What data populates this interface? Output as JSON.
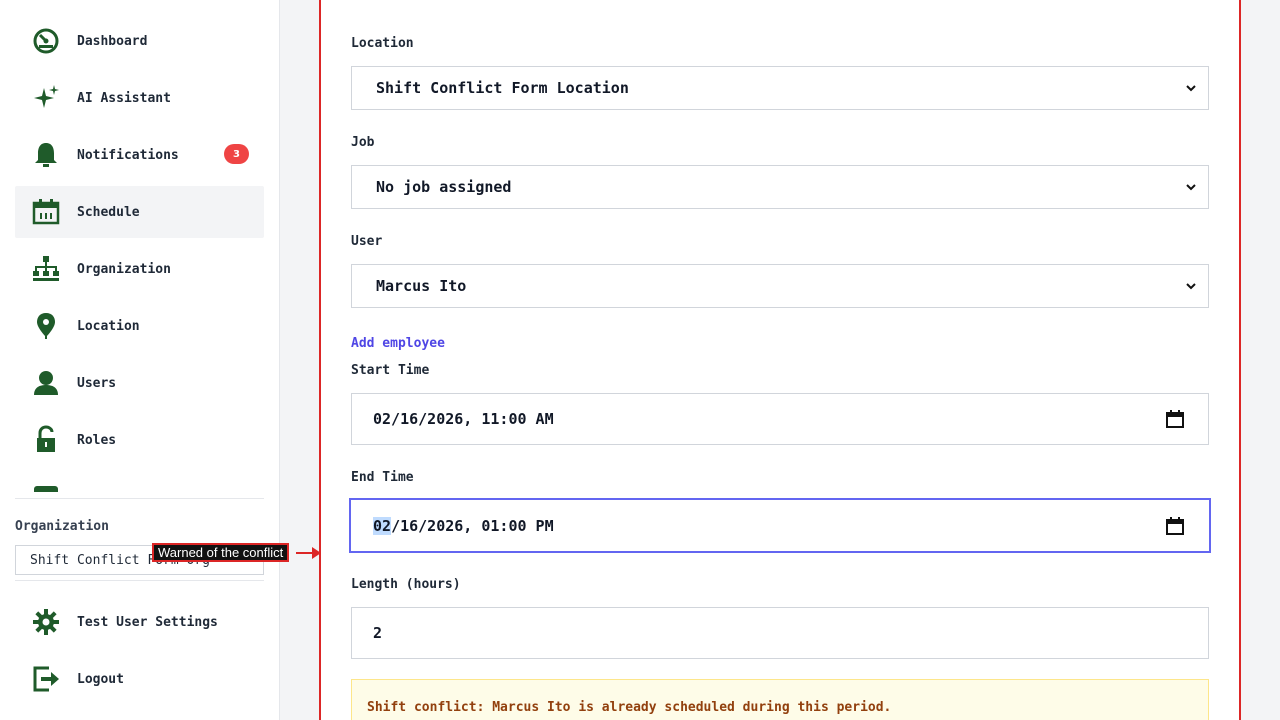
{
  "sidebar": {
    "items": [
      {
        "label": "Dashboard",
        "icon": "dashboard-icon"
      },
      {
        "label": "AI Assistant",
        "icon": "sparkle-icon"
      },
      {
        "label": "Notifications",
        "icon": "bell-icon",
        "badge": "3"
      },
      {
        "label": "Schedule",
        "icon": "calendar-icon",
        "active": true
      },
      {
        "label": "Organization",
        "icon": "org-chart-icon"
      },
      {
        "label": "Location",
        "icon": "map-pin-icon"
      },
      {
        "label": "Users",
        "icon": "user-icon"
      },
      {
        "label": "Roles",
        "icon": "unlock-icon"
      }
    ],
    "organization": {
      "label": "Organization",
      "value": "Shift Conflict Form Org"
    },
    "bottom": [
      {
        "label": "Test User Settings",
        "icon": "gear-icon"
      },
      {
        "label": "Logout",
        "icon": "logout-icon"
      }
    ]
  },
  "form": {
    "location": {
      "label": "Location",
      "value": "Shift Conflict Form Location"
    },
    "job": {
      "label": "Job",
      "value": "No job assigned"
    },
    "user": {
      "label": "User",
      "value": "Marcus Ito"
    },
    "add_employee": "Add employee",
    "start_time": {
      "label": "Start Time",
      "value": "02/16/2026, 11:00 AM"
    },
    "end_time": {
      "label": "End Time",
      "value_selected": "02",
      "value_rest": "/16/2026, 01:00 PM"
    },
    "length": {
      "label": "Length (hours)",
      "value": "2"
    },
    "conflict_message": "Shift conflict: Marcus Ito is already scheduled during this period."
  },
  "annotation": {
    "text": "Warned of the conflict"
  },
  "colors": {
    "icon": "#1f5b2a",
    "badge": "#ef4444",
    "accent": "#6366f1",
    "panel_border": "#dc2626"
  }
}
